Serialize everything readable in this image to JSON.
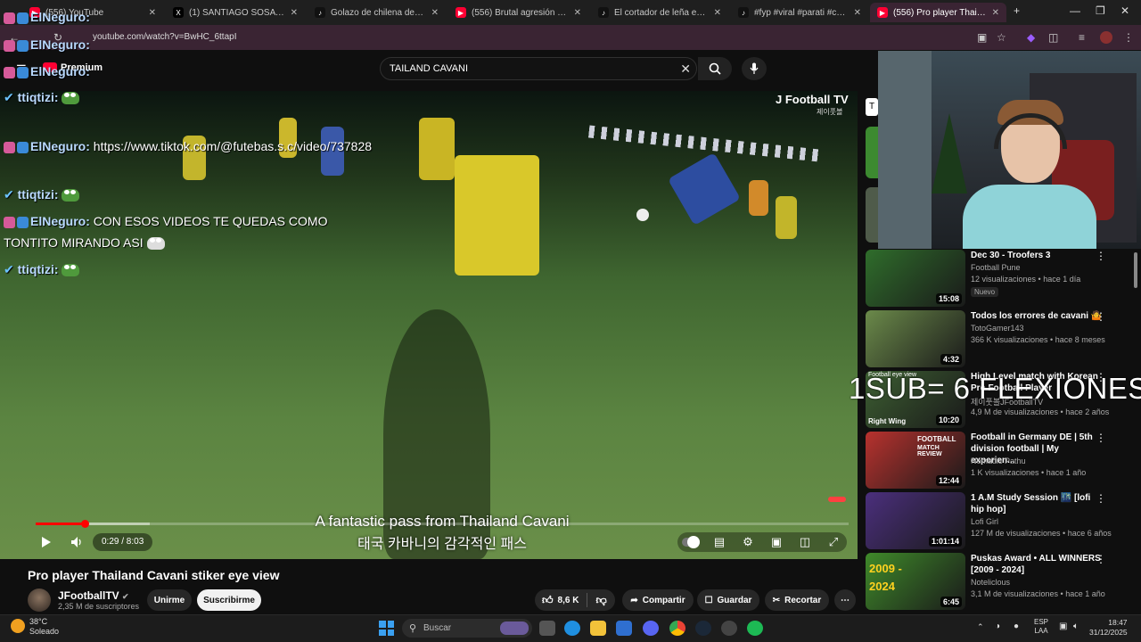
{
  "browser": {
    "tabs": [
      {
        "label": "(556) YouTube",
        "icon": "youtube-icon",
        "color": "#ff0033"
      },
      {
        "label": "(1) SANTIAGO SOSA - Search /",
        "icon": "x-icon",
        "color": "#000000"
      },
      {
        "label": "Golazo de chilena de McTomin",
        "icon": "tiktok-icon",
        "color": "#111111"
      },
      {
        "label": "(556) Brutal agresión de un fut",
        "icon": "youtube-icon",
        "color": "#ff0033"
      },
      {
        "label": "El cortador de leña en el fútbol",
        "icon": "tiktok-icon",
        "color": "#111111"
      },
      {
        "label": "#fyp #viral #parati #callejerofin",
        "icon": "tiktok-icon",
        "color": "#111111"
      },
      {
        "label": "(556) Pro player Thailand C",
        "icon": "youtube-icon",
        "color": "#ff0033"
      }
    ],
    "new_tab": "+",
    "url": "youtube.com/watch?v=BwHC_6ttapI"
  },
  "youtube": {
    "premium_label": "Premium",
    "search_value": "TAILAND CAVANI",
    "video": {
      "watermark": "J Football TV",
      "watermark_kr": "제이풋볼",
      "subtitle_en": "A fantastic pass from Thailand Cavani",
      "subtitle_kr": "태국 카바니의 감각적인 패스",
      "time": "0:29 / 8:03",
      "progress": 0.06,
      "buffered": 0.14
    },
    "title": "Pro player Thailand Cavani stiker eye view",
    "channel": {
      "name": "JFootballTV",
      "subs": "2,35 M de suscriptores",
      "verified": "✔"
    },
    "actions": {
      "join": "Unirme",
      "subscribe": "Suscribirme",
      "likes": "8,6 K",
      "share": "Compartir",
      "save": "Guardar",
      "clip": "Recortar",
      "more": "⋯"
    },
    "recommendations": [
      {
        "title": "Dec 30 - Troofers 3",
        "channel": "Football Pune",
        "meta": "12 visualizaciones • hace 1 día",
        "badge": "Nuevo",
        "duration": "15:08",
        "thumb": "#2f6d2b"
      },
      {
        "title": "Todos los errores de cavani 🤷",
        "channel": "TotoGamer143",
        "meta": "366 K visualizaciones • hace 8 meses",
        "badge": "",
        "duration": "4:32",
        "thumb": "#6b8a4a"
      },
      {
        "title": "High Level match with Korean Pro Football Player",
        "channel": "제이풋볼JFootballTV",
        "meta": "4,9 M de visualizaciones • hace 2 años",
        "badge": "",
        "duration": "10:20",
        "thumb": "#3d5f32"
      },
      {
        "title": "Football in Germany DE | 5th division football | My experien...",
        "channel": "Nomadic Pathu",
        "meta": "1 K visualizaciones • hace 1 año",
        "badge": "",
        "duration": "12:44",
        "thumb": "#b8322e"
      },
      {
        "title": "1 A.M Study Session 🌃 [lofi hip hop]",
        "channel": "Lofi Girl",
        "meta": "127 M de visualizaciones • hace 6 años",
        "badge": "",
        "duration": "1:01:14",
        "thumb": "#4b2f7d"
      },
      {
        "title": "Puskas Award • ALL WINNERS [2009 - 2024]",
        "channel": "Noteliclous",
        "meta": "3,1 M de visualizaciones • hace 1 año",
        "badge": "",
        "duration": "6:45",
        "thumb": "#3f8a2a"
      }
    ],
    "thumb_overlay": {
      "football_eye_view": "Football eye view",
      "right_wing": "Right Wing",
      "football": "FOOTBALL",
      "match_review": "MATCH REVIEW",
      "years": "2009 - 2024"
    }
  },
  "stream_overlay": {
    "chat": [
      {
        "user": "ElNeguro:",
        "text": "",
        "color": "#b9d9ff"
      },
      {
        "user": "ElNeguro:",
        "text": "",
        "color": "#b9d9ff"
      },
      {
        "user": "ElNeguro:",
        "text": "",
        "color": "#b9d9ff"
      },
      {
        "user": "ttiqtizi:",
        "text": "",
        "color": "#b9d9ff"
      },
      {
        "user": "ElNeguro:",
        "text": "https://www.tiktok.com/@futebas.s.c/video/737828",
        "color": "#b9d9ff"
      },
      {
        "user": "ttiqtizi:",
        "text": "",
        "color": "#b9d9ff"
      },
      {
        "user": "ElNeguro:",
        "text": "CON ESOS VIDEOS TE QUEDAS COMO",
        "text2": "TONTITO MIRANDO ASI",
        "color": "#b9d9ff"
      },
      {
        "user": "ttiqtizi:",
        "text": "",
        "color": "#b9d9ff"
      }
    ],
    "goal_text": "1SUB= 6 FLEXIONES"
  },
  "taskbar": {
    "weather_temp": "38°C",
    "weather_desc": "Soleado",
    "search_placeholder": "Buscar",
    "lang": "ESP",
    "lang2": "LAA",
    "time": "18:47",
    "date": "31/12/2025"
  }
}
